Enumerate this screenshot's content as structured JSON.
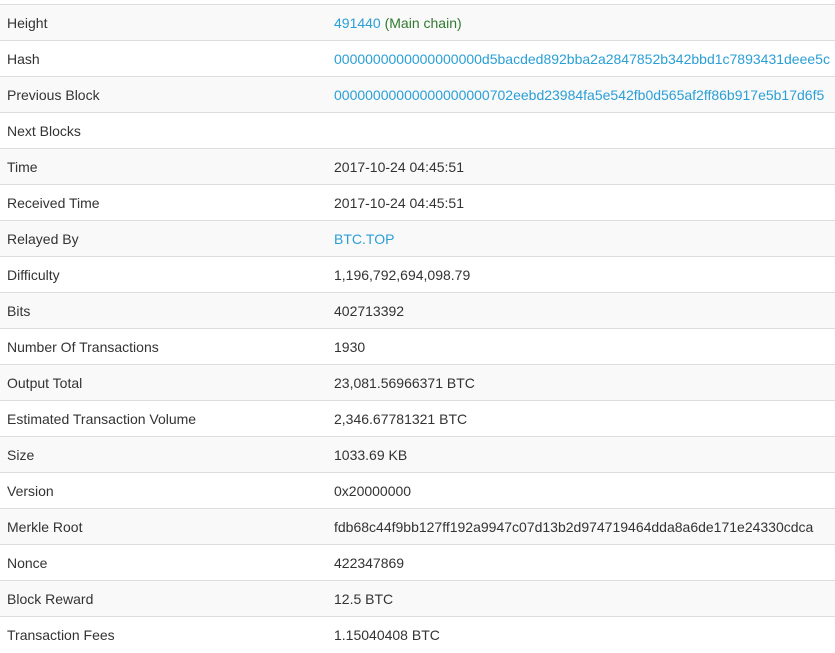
{
  "rows": {
    "height": {
      "label": "Height",
      "value": "491440",
      "status": "(Main chain)"
    },
    "hash": {
      "label": "Hash",
      "value": "0000000000000000000d5bacded892bba2a2847852b342bbd1c7893431deee5c"
    },
    "previous_block": {
      "label": "Previous Block",
      "value": "00000000000000000000702eebd23984fa5e542fb0d565af2ff86b917e5b17d6f5"
    },
    "next_blocks": {
      "label": "Next Blocks",
      "value": ""
    },
    "time": {
      "label": "Time",
      "value": "2017-10-24 04:45:51"
    },
    "received_time": {
      "label": "Received Time",
      "value": "2017-10-24 04:45:51"
    },
    "relayed_by": {
      "label": "Relayed By",
      "value": "BTC.TOP"
    },
    "difficulty": {
      "label": "Difficulty",
      "value": "1,196,792,694,098.79"
    },
    "bits": {
      "label": "Bits",
      "value": "402713392"
    },
    "num_transactions": {
      "label": "Number Of Transactions",
      "value": "1930"
    },
    "output_total": {
      "label": "Output Total",
      "value": "23,081.56966371 BTC"
    },
    "est_tx_volume": {
      "label": "Estimated Transaction Volume",
      "value": "2,346.67781321 BTC"
    },
    "size": {
      "label": "Size",
      "value": "1033.69 KB"
    },
    "version": {
      "label": "Version",
      "value": "0x20000000"
    },
    "merkle_root": {
      "label": "Merkle Root",
      "value": "fdb68c44f9bb127ff192a9947c07d13b2d974719464dda8a6de171e24330cdca"
    },
    "nonce": {
      "label": "Nonce",
      "value": "422347869"
    },
    "block_reward": {
      "label": "Block Reward",
      "value": "12.5 BTC"
    },
    "transaction_fees": {
      "label": "Transaction Fees",
      "value": "1.15040408 BTC"
    }
  },
  "colors": {
    "link": "#2a9fd6",
    "status_green": "#2f7a2f",
    "row_stripe": "#f9f9f9",
    "border": "#dddddd",
    "text": "#333333"
  }
}
